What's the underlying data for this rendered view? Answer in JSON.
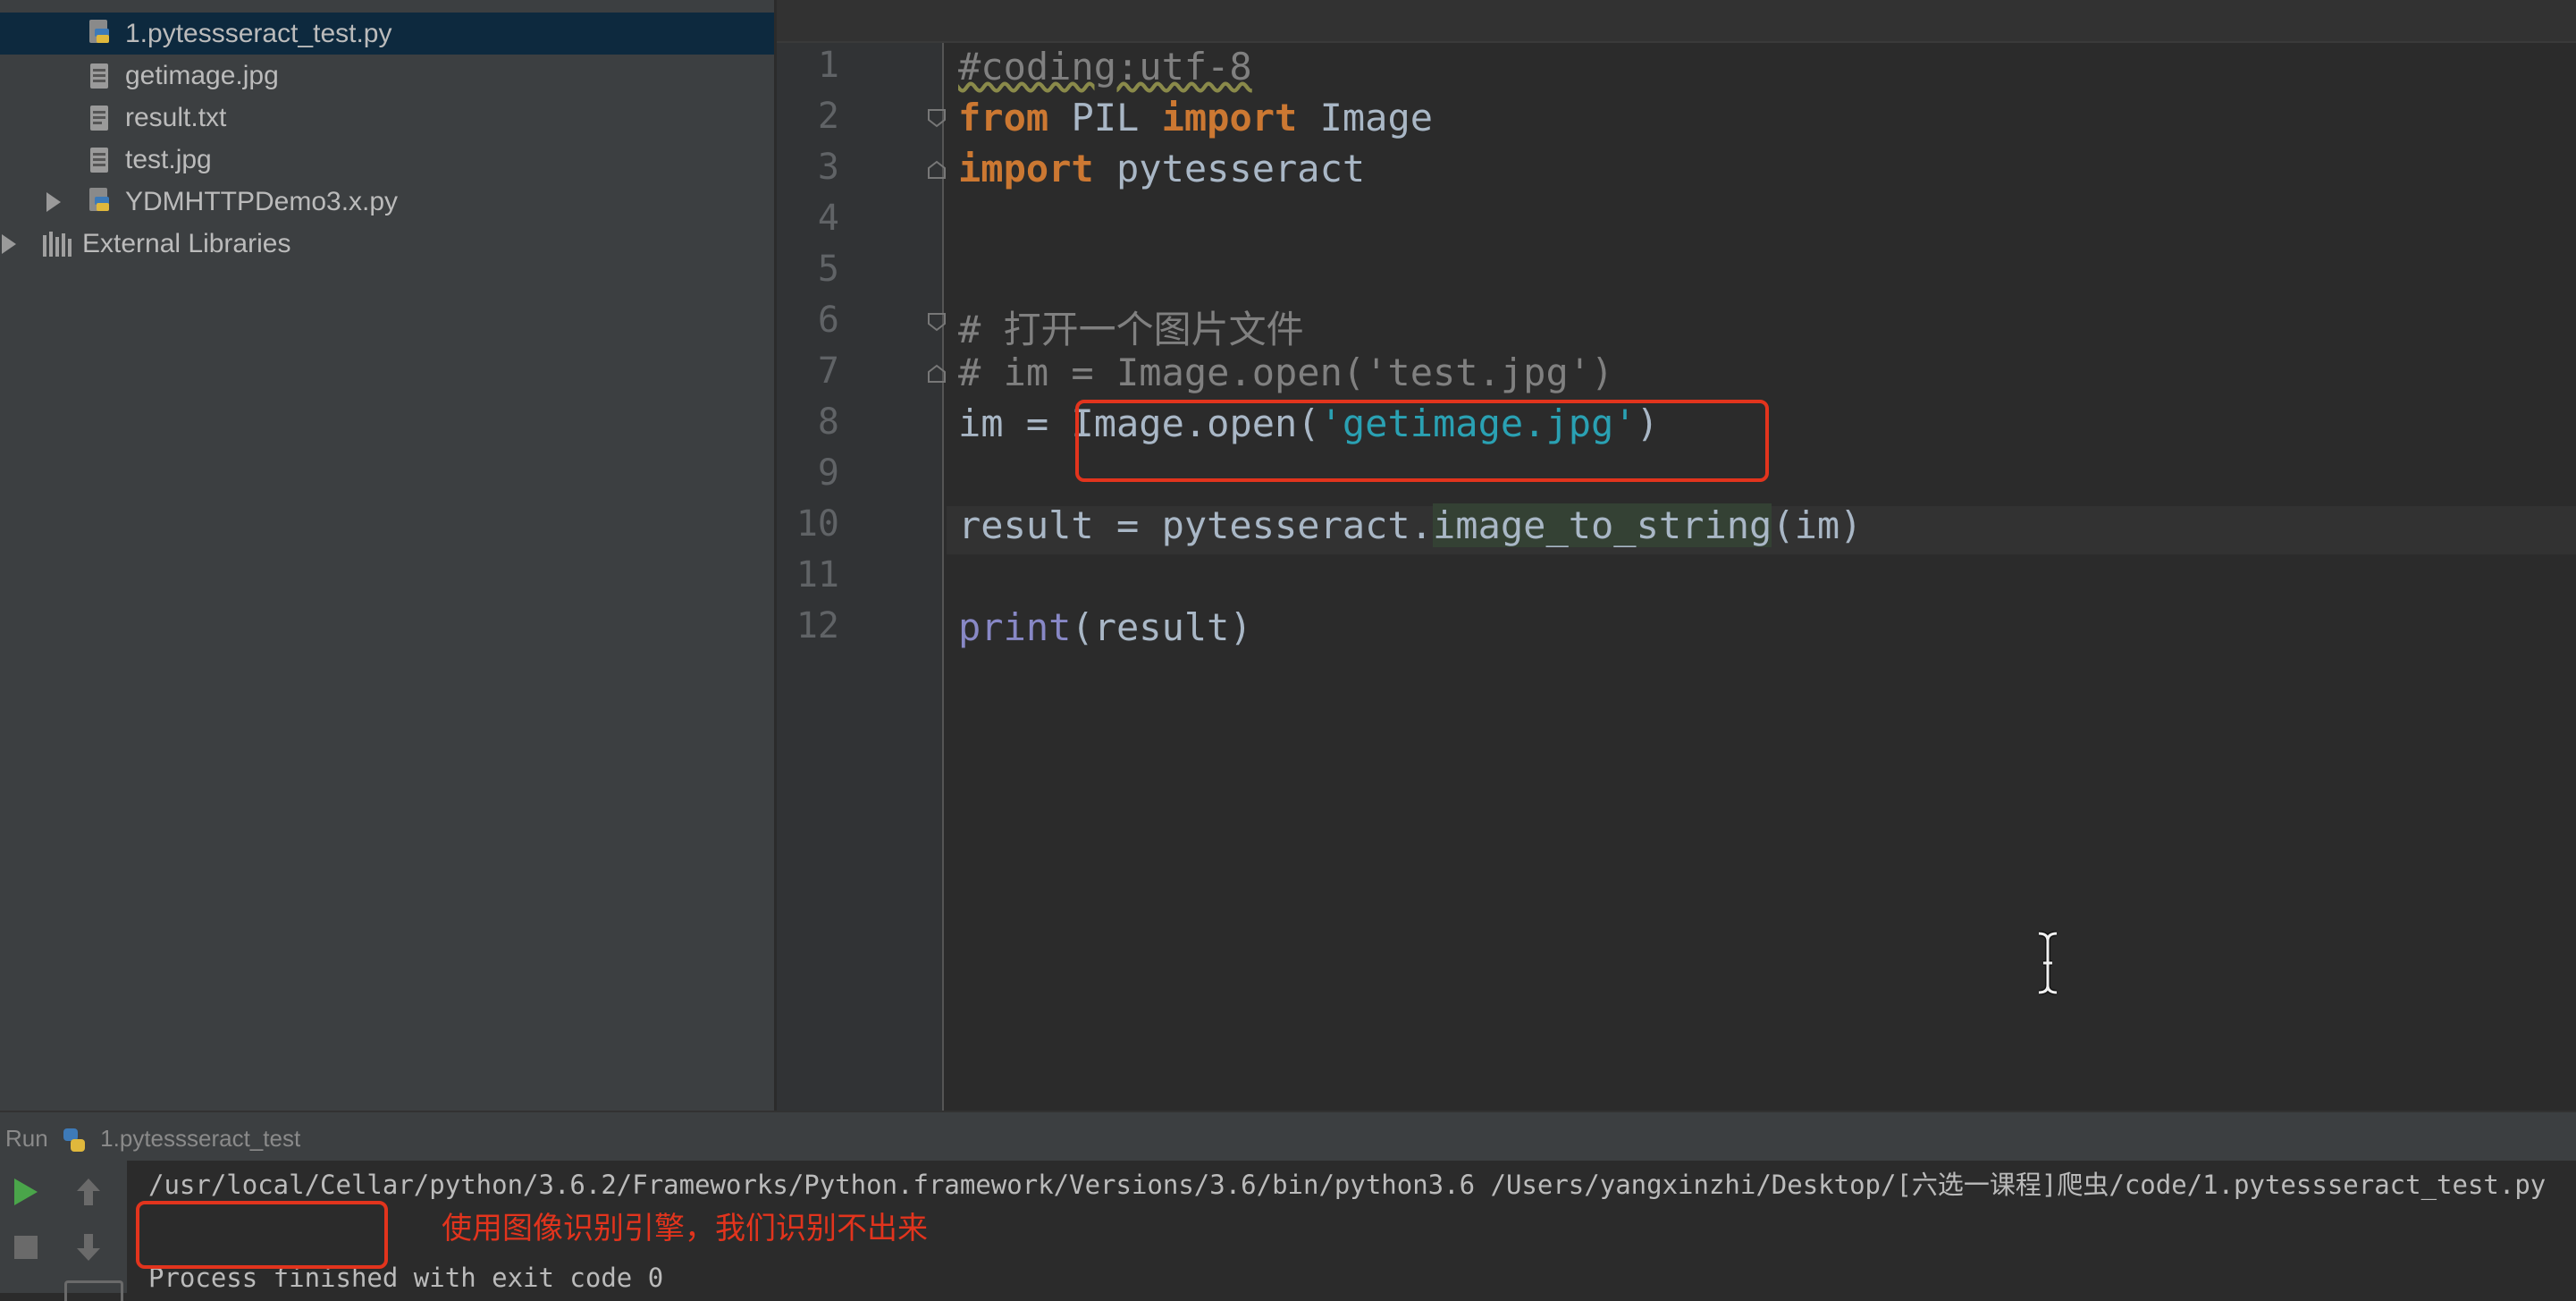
{
  "project_tree": {
    "items": [
      {
        "label": "1.pytessseract_test.py",
        "type": "python",
        "selected": true
      },
      {
        "label": "getimage.jpg",
        "type": "image"
      },
      {
        "label": "result.txt",
        "type": "text"
      },
      {
        "label": "test.jpg",
        "type": "image"
      },
      {
        "label": "YDMHTTPDemo3.x.py",
        "type": "python",
        "collapsed": true
      },
      {
        "label": "External Libraries",
        "type": "library",
        "collapsed": true
      }
    ]
  },
  "editor": {
    "line_numbers": [
      "1",
      "2",
      "3",
      "4",
      "5",
      "6",
      "7",
      "8",
      "9",
      "10",
      "11",
      "12"
    ],
    "lines": {
      "l1": "#coding:utf-8",
      "l2_from": "from",
      "l2_pil": " PIL ",
      "l2_import": "import",
      "l2_image": " Image",
      "l3_import": "import",
      "l3_mod": " pytesseract",
      "l6": "# 打开一个图片文件",
      "l7": "# im = Image.open('test.jpg')",
      "l8_a": "im = ",
      "l8_b": "Image.open(",
      "l8_str": "'getimage.jpg'",
      "l8_c": ")",
      "l10_a": "result = pytesseract.",
      "l10_b": "image_to_string",
      "l10_c": "(im)",
      "l12_fn": "print",
      "l12_rest": "(result)"
    }
  },
  "run_panel": {
    "label": "Run",
    "config_name": "1.pytessseract_test",
    "console": {
      "command": "/usr/local/Cellar/python/3.6.2/Frameworks/Python.framework/Versions/3.6/bin/python3.6 /Users/yangxinzhi/Desktop/[六选一课程]爬虫/code/1.pytessseract_test.py",
      "exit": "Process finished with exit code 0"
    },
    "annotation": "使用图像识别引擎，我们识别不出来"
  },
  "colors": {
    "keyword": "#cc7832",
    "string": "#2aa1b3",
    "annotation": "#e2341d",
    "selection": "#0d293e"
  },
  "icons": [
    "python-file-icon",
    "image-file-icon",
    "text-file-icon",
    "library-icon",
    "run-icon",
    "stop-icon",
    "up-arrow-icon",
    "down-arrow-icon",
    "text-cursor-icon"
  ]
}
